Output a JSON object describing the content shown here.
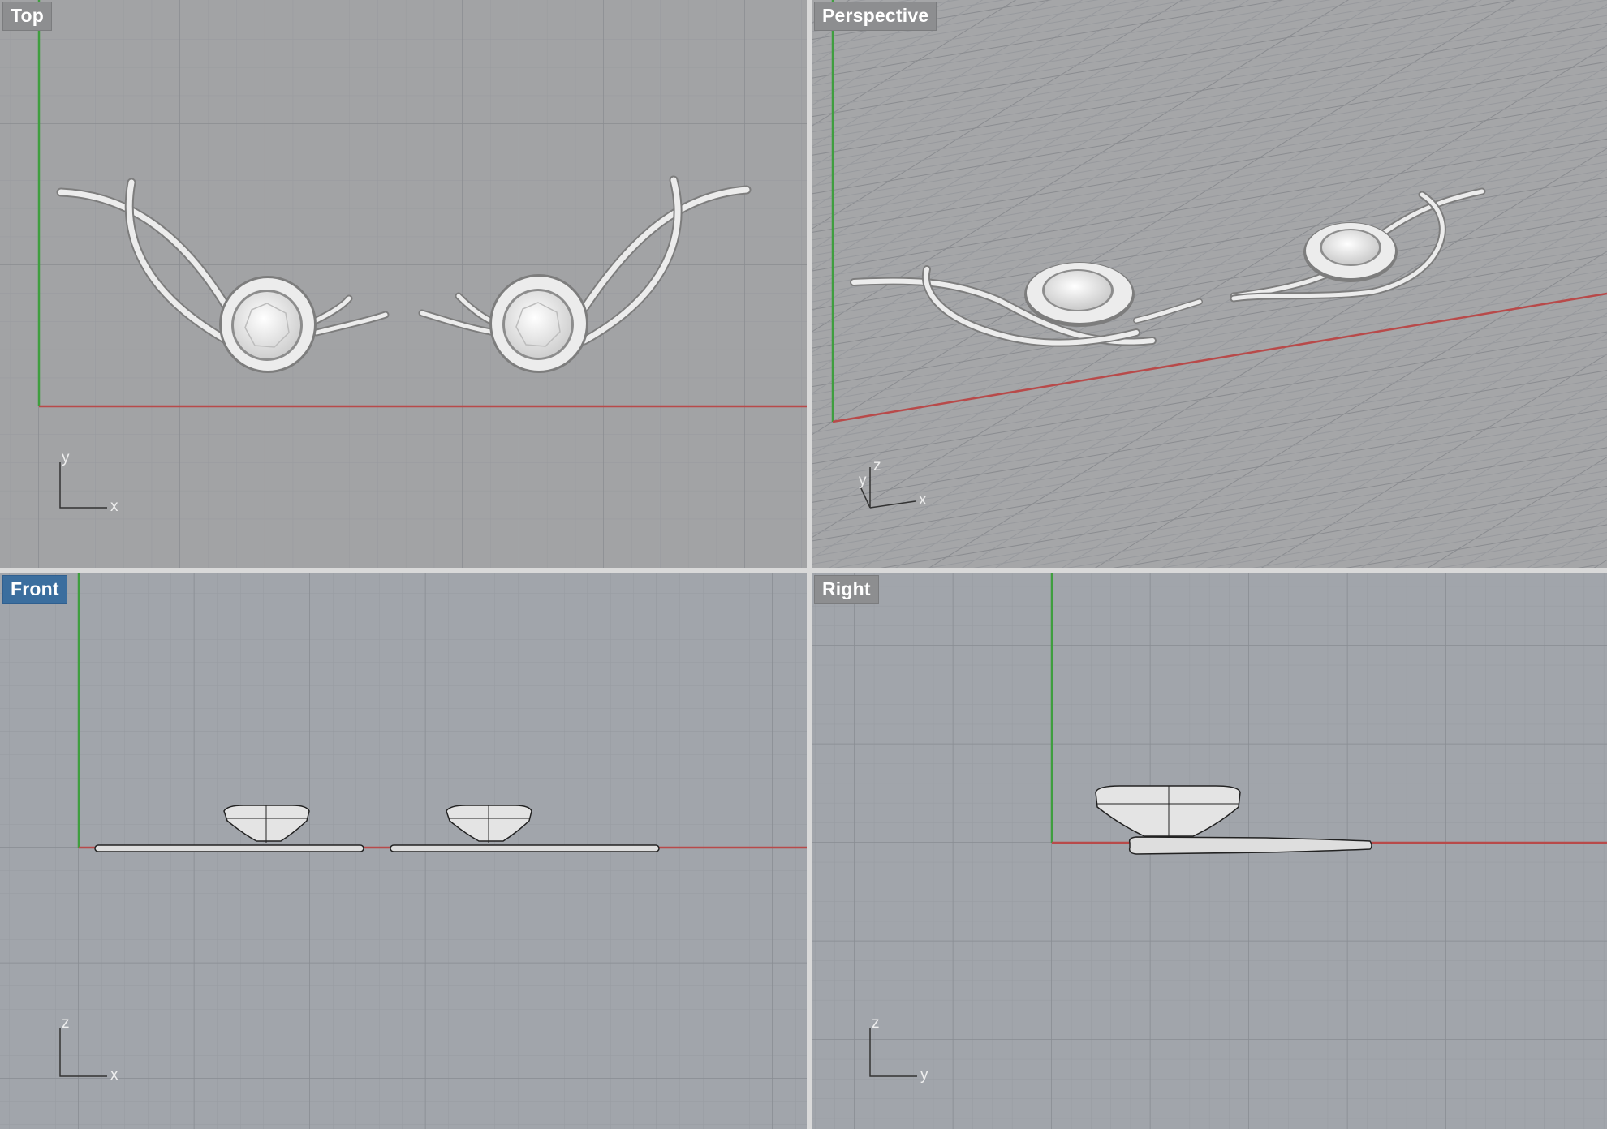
{
  "viewports": {
    "top": {
      "label": "Top",
      "active": false,
      "axes": [
        "y",
        "x"
      ]
    },
    "perspective": {
      "label": "Perspective",
      "active": false,
      "axes": [
        "z",
        "y",
        "x"
      ]
    },
    "front": {
      "label": "Front",
      "active": true,
      "axes": [
        "z",
        "x"
      ]
    },
    "right": {
      "label": "Right",
      "active": false,
      "axes": [
        "z",
        "y"
      ]
    }
  },
  "colors": {
    "x_axis": "#b84a4a",
    "y_axis": "#3f9e3f",
    "grid_minor": "#9699a0",
    "grid_major": "#8a8c92",
    "active_label": "#3b6e9e",
    "model": "#e9e9e9"
  }
}
